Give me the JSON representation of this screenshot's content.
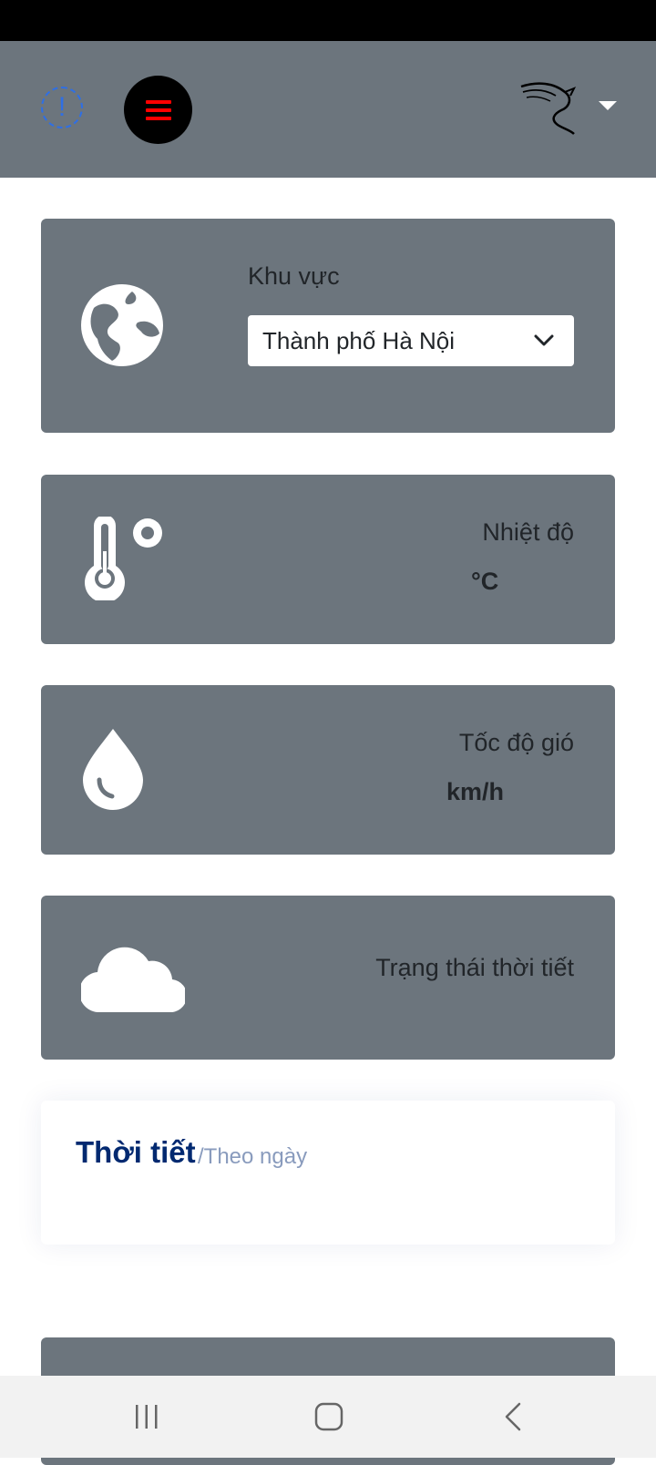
{
  "header": {
    "alert_icon": "exclamation-circle-icon",
    "menu_icon": "hamburger-icon",
    "user_logo": "dragon-logo",
    "dropdown_icon": "caret-down-icon",
    "accent": "#2f6fe4",
    "menu_color": "#ff0000"
  },
  "region": {
    "icon": "globe-icon",
    "label": "Khu vực",
    "selected": "Thành phố Hà Nội"
  },
  "temperature": {
    "icon": "thermometer-icon",
    "label": "Nhiệt độ",
    "unit": "°C"
  },
  "wind": {
    "icon": "droplet-icon",
    "label": "Tốc độ gió",
    "unit": "km/h"
  },
  "weather_state": {
    "icon": "cloud-icon",
    "label": "Trạng thái thời tiết"
  },
  "weather_panel": {
    "title": "Thời tiết",
    "subtitle": "/Theo ngày"
  },
  "nav": {
    "recents_icon": "recents-icon",
    "home_icon": "home-icon",
    "back_icon": "back-icon"
  }
}
